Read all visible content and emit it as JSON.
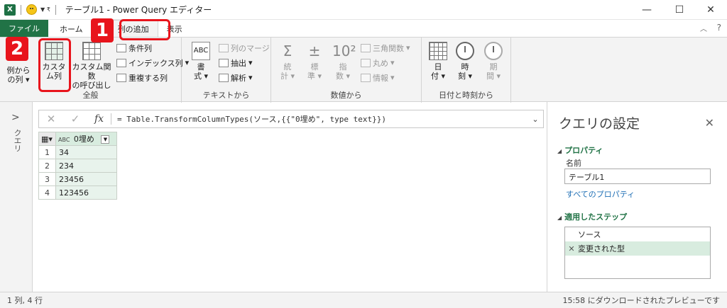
{
  "titlebar": {
    "app_icon": "X",
    "title": "テーブル1 - Power Query エディター"
  },
  "tabs": [
    "ファイル",
    "ホーム",
    "列の追加",
    "表示"
  ],
  "ribbon": {
    "general": {
      "example_cols": [
        "例から",
        "の列"
      ],
      "custom_col": [
        "カスタ",
        "ム列"
      ],
      "custom_func": [
        "カスタム関数",
        "の呼び出し"
      ],
      "conditional": "条件列",
      "index": "インデックス列",
      "duplicate": "重複する列",
      "group": "全般"
    },
    "text": {
      "format": [
        "書",
        "式"
      ],
      "merge": "列のマージ",
      "extract": "抽出",
      "parse": "解析",
      "group": "テキストから"
    },
    "number": {
      "stats": [
        "統",
        "計"
      ],
      "standard": [
        "標",
        "準"
      ],
      "scientific": [
        "指",
        "数"
      ],
      "trig": "三角関数",
      "round": "丸め",
      "info": "情報",
      "group": "数値から"
    },
    "datetime": {
      "date": [
        "日",
        "付"
      ],
      "time": [
        "時",
        "刻"
      ],
      "duration": [
        "期",
        "間"
      ],
      "group": "日付と時刻から"
    }
  },
  "badges": [
    "1",
    "2"
  ],
  "queries_label": "クエリ",
  "formula": "= Table.TransformColumnTypes(ソース,{{\"0埋め\", type text}})",
  "grid": {
    "column_type": "ABC",
    "column": "0埋め",
    "rows": [
      {
        "n": "1",
        "v": "34"
      },
      {
        "n": "2",
        "v": "234"
      },
      {
        "n": "3",
        "v": "23456"
      },
      {
        "n": "4",
        "v": "123456"
      }
    ]
  },
  "settings": {
    "title": "クエリの設定",
    "properties": "プロパティ",
    "name_label": "名前",
    "name_value": "テーブル1",
    "all_props": "すべてのプロパティ",
    "steps_title": "適用したステップ",
    "steps": [
      "ソース",
      "変更された型"
    ]
  },
  "status": {
    "left": "1 列, 4 行",
    "right": "15:58 にダウンロードされたプレビューです"
  }
}
